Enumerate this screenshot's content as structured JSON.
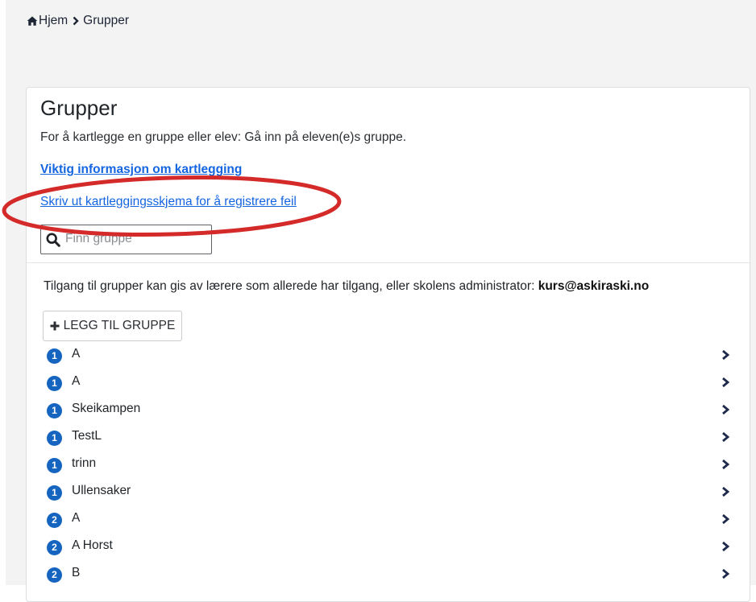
{
  "breadcrumb": {
    "home_label": "Hjem",
    "current_label": "Grupper"
  },
  "header": {
    "title": "Grupper",
    "intro": "For å kartlegge en gruppe eller elev: Gå inn på eleven(e)s gruppe.",
    "important_link": "Viktig informasjon om kartlegging",
    "print_link": "Skriv ut kartleggingsskjema for å registrere feil"
  },
  "search": {
    "placeholder": "Finn gruppe",
    "value": ""
  },
  "access": {
    "text": "Tilgang til grupper kan gis av lærere som allerede har tilgang, eller skolens administrator: ",
    "email": "kurs@askiraski.no"
  },
  "add_button": {
    "label": "LEGG TIL GRUPPE"
  },
  "groups": [
    {
      "level": "1",
      "name": "A"
    },
    {
      "level": "1",
      "name": "A"
    },
    {
      "level": "1",
      "name": "Skeikampen"
    },
    {
      "level": "1",
      "name": "TestL"
    },
    {
      "level": "1",
      "name": "trinn"
    },
    {
      "level": "1",
      "name": "Ullensaker"
    },
    {
      "level": "2",
      "name": "A"
    },
    {
      "level": "2",
      "name": "A Horst"
    },
    {
      "level": "2",
      "name": "B"
    }
  ],
  "colors": {
    "link": "#1565e0",
    "badge": "#1565c0",
    "annotation_ring": "#d42a2a",
    "chevron": "#1d2a4a"
  }
}
